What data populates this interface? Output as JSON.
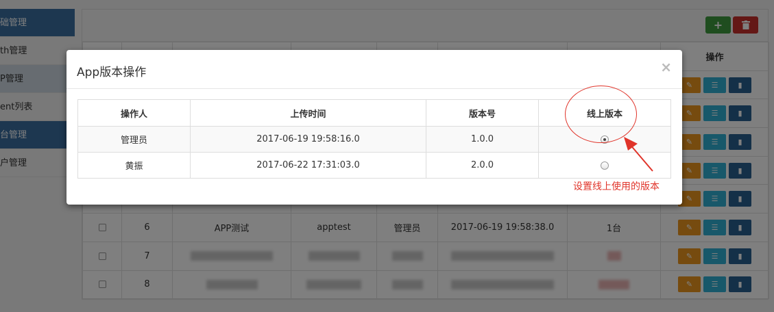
{
  "sidebar": {
    "items": [
      {
        "label": "础管理",
        "type": "head"
      },
      {
        "label": "th管理",
        "type": "normal"
      },
      {
        "label": "P管理",
        "type": "active"
      },
      {
        "label": "ent列表",
        "type": "normal"
      },
      {
        "label": "台管理",
        "type": "head"
      },
      {
        "label": "户管理",
        "type": "normal"
      }
    ]
  },
  "toolbar": {
    "add_icon": "plus-icon",
    "delete_icon": "trash-icon"
  },
  "background_table": {
    "header_action": "操作",
    "rows": [
      {
        "no": "6",
        "name": "APP测试",
        "code": "apptest",
        "operator": "管理员",
        "time": "2017-06-19 19:58:38.0",
        "count": "1台"
      },
      {
        "no": "7",
        "name": "",
        "code": "",
        "operator": "",
        "time": "",
        "count": ""
      },
      {
        "no": "8",
        "name": "",
        "code": "",
        "operator": "",
        "time": "",
        "count": ""
      }
    ]
  },
  "modal": {
    "title": "App版本操作",
    "close": "×",
    "columns": [
      "操作人",
      "上传时间",
      "版本号",
      "线上版本"
    ],
    "rows": [
      {
        "operator": "管理员",
        "upload_time": "2017-06-19 19:58:16.0",
        "version": "1.0.0",
        "online": true
      },
      {
        "operator": "黄振",
        "upload_time": "2017-06-22 17:31:03.0",
        "version": "2.0.0",
        "online": false
      }
    ]
  },
  "annotation": {
    "text": "设置线上使用的版本",
    "color": "#e0342a"
  },
  "colors": {
    "sidebar_head": "#3b6ea0",
    "btn_add": "#3e9a3e",
    "btn_delete": "#c9302c",
    "btn_edit": "#ec971f",
    "btn_list": "#31b0d5",
    "btn_stat": "#286090"
  }
}
